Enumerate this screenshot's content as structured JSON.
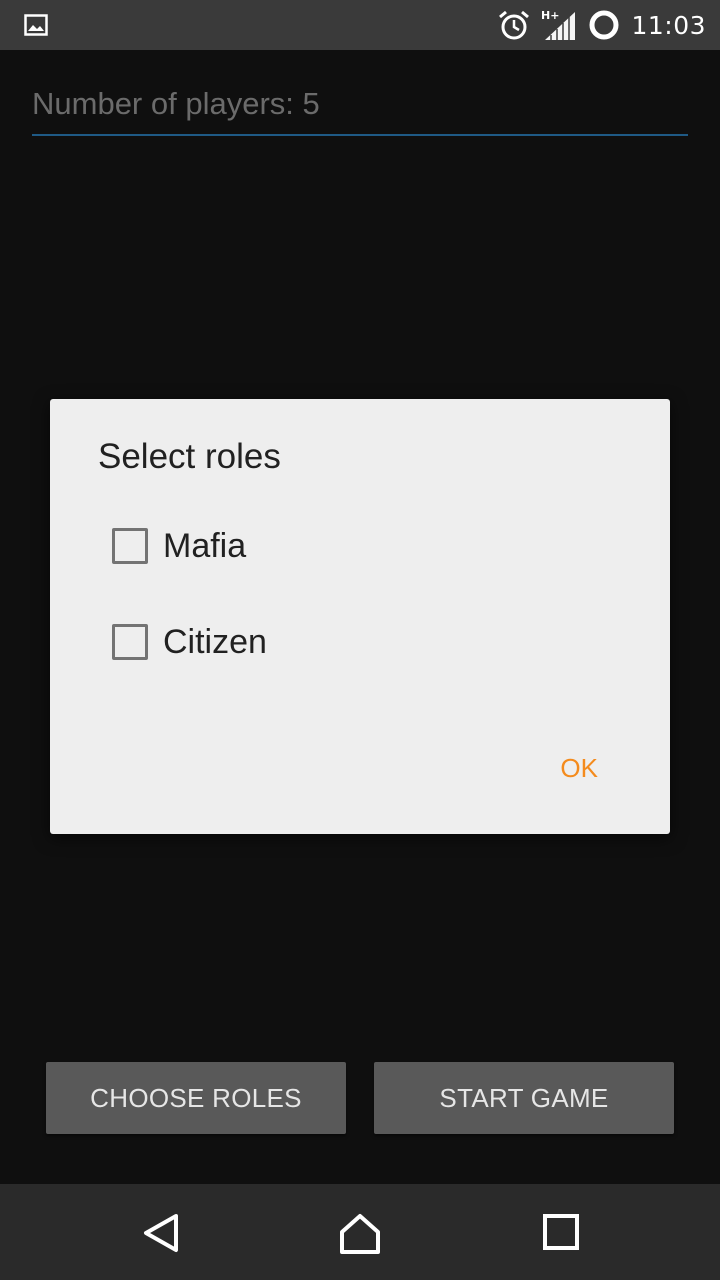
{
  "status_bar": {
    "time": "11:03",
    "icons": [
      "gallery-notification-icon",
      "alarm-icon",
      "signal-hplus-icon",
      "battery-ring-icon"
    ]
  },
  "players_field": {
    "text": "Number of players: 5"
  },
  "dialog": {
    "title": "Select roles",
    "roles": [
      {
        "label": "Mafia",
        "checked": false
      },
      {
        "label": "Citizen",
        "checked": false
      }
    ],
    "ok_label": "OK"
  },
  "buttons": {
    "choose_roles": "CHOOSE ROLES",
    "start_game": "START GAME"
  },
  "nav_bar": {
    "icons": [
      "back-icon",
      "home-icon",
      "recents-icon"
    ]
  },
  "colors": {
    "accent": "#f48b1d",
    "field_underline": "#1f5a85",
    "background": "#0f0f0f",
    "dialog_bg": "#eeeeee",
    "button_bg": "#595959"
  }
}
